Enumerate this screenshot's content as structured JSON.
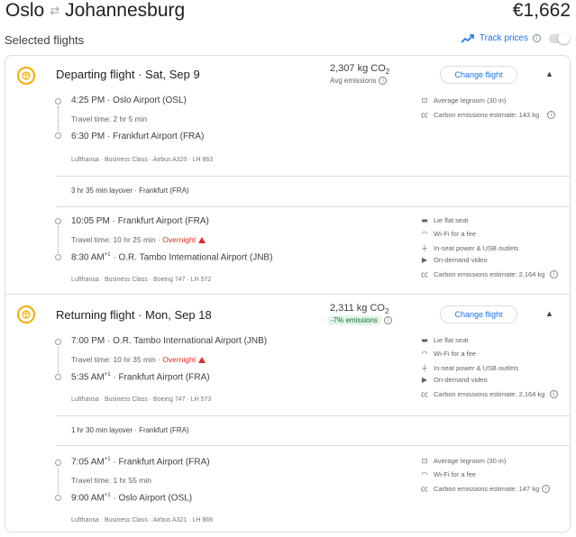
{
  "header": {
    "origin": "Oslo",
    "destination": "Johannesburg",
    "price": "€1,662"
  },
  "selected_title": "Selected flights",
  "track_prices": "Track prices",
  "departing": {
    "title": "Departing flight · Sat, Sep 9",
    "co2": "2,307 kg CO",
    "co2_sub": "Avg emissions",
    "change": "Change flight",
    "leg1": {
      "dep_time": "4:25 PM",
      "dep_airport": "Oslo Airport (OSL)",
      "travel": "Travel time: 2 hr 5 min",
      "arr_time": "6:30 PM",
      "arr_airport": "Frankfurt Airport (FRA)",
      "meta": "Lufthansa · Business Class · Airbus A320 · LH 863",
      "amenities": [
        "Average legroom (30 in)",
        "Carbon emissions estimate: 143 kg"
      ]
    },
    "layover": "3 hr 35 min layover · Frankfurt (FRA)",
    "leg2": {
      "dep_time": "10:05 PM",
      "dep_airport": "Frankfurt Airport (FRA)",
      "travel": "Travel time: 10 hr 25 min · ",
      "overnight": "Overnight",
      "arr_time": "8:30 AM",
      "arr_sup": "+1",
      "arr_airport": "O.R. Tambo International Airport (JNB)",
      "meta": "Lufthansa · Business Class · Boeing 747 · LH 572",
      "amenities": [
        "Lie flat seat",
        "Wi-Fi for a fee",
        "In-seat power & USB outlets",
        "On-demand video",
        "Carbon emissions estimate: 2,164 kg"
      ]
    }
  },
  "returning": {
    "title": "Returning flight · Mon, Sep 18",
    "co2": "2,311 kg CO",
    "co2_badge": "-7% emissions",
    "change": "Change flight",
    "leg1": {
      "dep_time": "7:00 PM",
      "dep_airport": "O.R. Tambo International Airport (JNB)",
      "travel": "Travel time: 10 hr 35 min · ",
      "overnight": "Overnight",
      "arr_time": "5:35 AM",
      "arr_sup": "+1",
      "arr_airport": "Frankfurt Airport (FRA)",
      "meta": "Lufthansa · Business Class · Boeing 747 · LH 573",
      "amenities": [
        "Lie flat seat",
        "Wi-Fi for a fee",
        "In-seat power & USB outlets",
        "On-demand video",
        "Carbon emissions estimate: 2,164 kg"
      ]
    },
    "layover": "1 hr 30 min layover · Frankfurt (FRA)",
    "leg2": {
      "dep_time": "7:05 AM",
      "dep_sup": "+1",
      "dep_airport": "Frankfurt Airport (FRA)",
      "travel": "Travel time: 1 hr 55 min",
      "arr_time": "9:00 AM",
      "arr_sup": "+1",
      "arr_airport": "Oslo Airport (OSL)",
      "meta": "Lufthansa · Business Class · Airbus A321 · LH 866",
      "amenities": [
        "Average legroom (30 in)",
        "Wi-Fi for a fee",
        "Carbon emissions estimate: 147 kg"
      ]
    }
  },
  "colors": {
    "accent": "#1a73e8",
    "overnight": "#d93025",
    "badge_bg": "#e6f4ea",
    "logo": "#f9ab00"
  }
}
